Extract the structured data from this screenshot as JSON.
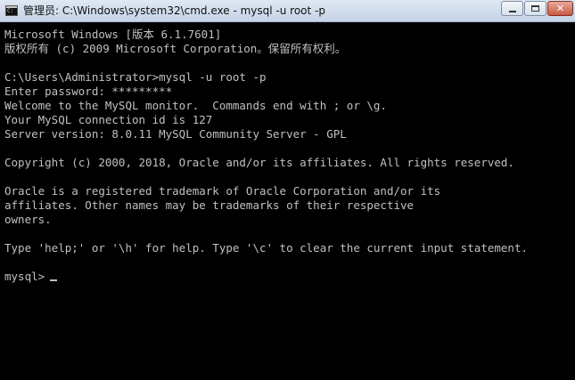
{
  "window": {
    "title": "管理员: C:\\Windows\\system32\\cmd.exe - mysql  -u root -p",
    "icon": "cmd-icon",
    "close_glyph": "✕"
  },
  "console": {
    "lines": [
      "Microsoft Windows [版本 6.1.7601]",
      "版权所有 (c) 2009 Microsoft Corporation。保留所有权利。",
      "C:\\Users\\Administrator>mysql -u root -p",
      "Enter password: *********",
      "Welcome to the MySQL monitor.  Commands end with ; or \\g.",
      "Your MySQL connection id is 127",
      "Server version: 8.0.11 MySQL Community Server - GPL",
      "Copyright (c) 2000, 2018, Oracle and/or its affiliates. All rights reserved.",
      "Oracle is a registered trademark of Oracle Corporation and/or its",
      "affiliates. Other names may be trademarks of their respective",
      "owners.",
      "Type 'help;' or '\\h' for help. Type '\\c' to clear the current input statement."
    ],
    "prompt": "mysql>"
  },
  "colors": {
    "background": "#000000",
    "text": "#c0c0c0"
  }
}
